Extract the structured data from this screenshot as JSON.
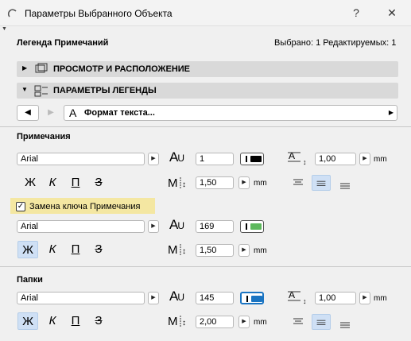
{
  "window": {
    "title": "Параметры Выбранного Объекта",
    "help": "?",
    "close": "✕"
  },
  "header": {
    "name": "Легенда Примечаний",
    "selection_info": "Выбрано: 1 Редактируемых: 1"
  },
  "sections": {
    "view_placement": "ПРОСМОТР И РАСПОЛОЖЕНИЕ",
    "legend_params": "ПАРАМЕТРЫ ЛЕГЕНДЫ"
  },
  "nav": {
    "dropdown_label": "Формат текста..."
  },
  "notes": {
    "heading": "Примечания",
    "font": "Arial",
    "pen": "1",
    "pen_color": "#000000",
    "size": "1,00",
    "size_unit": "mm",
    "width": "1,50",
    "width_unit": "mm",
    "styles": [
      "Ж",
      "К",
      "П",
      "З"
    ]
  },
  "override": {
    "checkbox_label": "Замена ключа Примечания",
    "checked": true,
    "font": "Arial",
    "pen": "169",
    "pen_color": "#5cb85c",
    "width": "1,50",
    "width_unit": "mm",
    "styles": [
      "Ж",
      "К",
      "П",
      "З"
    ]
  },
  "folders": {
    "heading": "Папки",
    "font": "Arial",
    "pen": "145",
    "pen_color": "#1a74c2",
    "size": "1,00",
    "size_unit": "mm",
    "width": "2,00",
    "width_unit": "mm",
    "styles": [
      "Ж",
      "К",
      "П",
      "З"
    ]
  }
}
